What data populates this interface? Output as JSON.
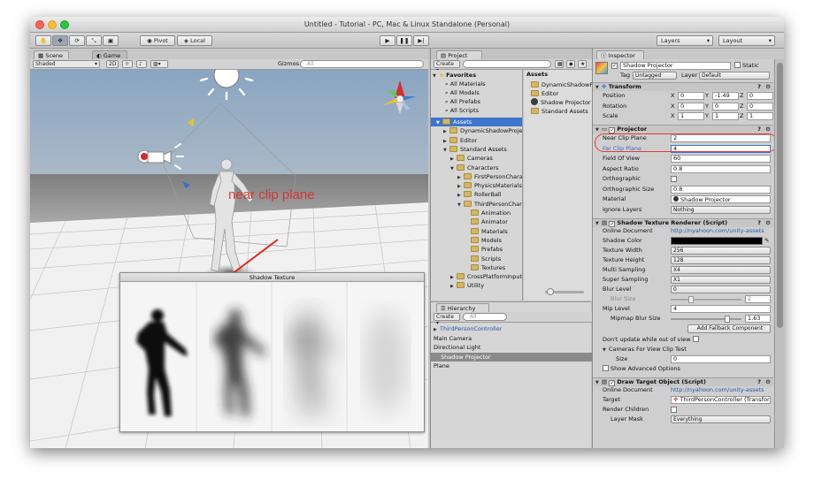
{
  "window": {
    "title": "Untitled - Tutorial - PC, Mac & Linux Standalone (Personal)"
  },
  "toolbar": {
    "pivot_label": "Pivot",
    "local_label": "Local",
    "layers_label": "Layers",
    "layout_label": "Layout"
  },
  "scene": {
    "tabs": [
      "Scene",
      "Game"
    ],
    "shading_mode": "Shaded",
    "mode_2d": "2D",
    "gizmos_label": "Gizmos",
    "search_placeholder": "All",
    "annotation": "near clip plane",
    "preview_title": "Shadow Texture"
  },
  "project": {
    "tab": "Project",
    "create_label": "Create",
    "favorites": {
      "label": "Favorites",
      "items": [
        "All Materials",
        "All Models",
        "All Prefabs",
        "All Scripts"
      ]
    },
    "tree": [
      {
        "label": "Assets",
        "depth": 0,
        "selected": true
      },
      {
        "label": "DynamicShadowProjector",
        "depth": 1
      },
      {
        "label": "Editor",
        "depth": 1
      },
      {
        "label": "Standard Assets",
        "depth": 1
      },
      {
        "label": "Cameras",
        "depth": 2
      },
      {
        "label": "Characters",
        "depth": 2
      },
      {
        "label": "FirstPersonCharacter",
        "depth": 3
      },
      {
        "label": "PhysicsMaterials",
        "depth": 3
      },
      {
        "label": "RollerBall",
        "depth": 3
      },
      {
        "label": "ThirdPersonCharacter",
        "depth": 3
      },
      {
        "label": "Animation",
        "depth": 4
      },
      {
        "label": "Animator",
        "depth": 4
      },
      {
        "label": "Materials",
        "depth": 4
      },
      {
        "label": "Models",
        "depth": 4
      },
      {
        "label": "Prefabs",
        "depth": 4
      },
      {
        "label": "Scripts",
        "depth": 4
      },
      {
        "label": "Textures",
        "depth": 4
      },
      {
        "label": "CrossPlatformInput",
        "depth": 2
      },
      {
        "label": "Utility",
        "depth": 2
      }
    ],
    "assets_header": "Assets",
    "assets": [
      "DynamicShadowProjector",
      "Editor",
      "Shadow Projector",
      "Standard Assets"
    ]
  },
  "hierarchy": {
    "tab": "Hierarchy",
    "create_label": "Create",
    "search_placeholder": "All",
    "items": [
      {
        "label": "ThirdPersonController",
        "indent": 0,
        "prefab": true
      },
      {
        "label": "Main Camera",
        "indent": 0
      },
      {
        "label": "Directional Light",
        "indent": 0
      },
      {
        "label": "Shadow Projector",
        "indent": 1,
        "selected": true
      },
      {
        "label": "Plane",
        "indent": 0
      }
    ]
  },
  "inspector": {
    "tab": "Inspector",
    "object_name": "Shadow Projector",
    "static_label": "Static",
    "tag_label": "Tag",
    "tag_value": "Untagged",
    "layer_label": "Layer",
    "layer_value": "Default",
    "transform": {
      "title": "Transform",
      "rows": [
        {
          "label": "Position",
          "x": "0",
          "y": "-1.49",
          "z": "0"
        },
        {
          "label": "Rotation",
          "x": "0",
          "y": "0",
          "z": "0"
        },
        {
          "label": "Scale",
          "x": "1",
          "y": "1",
          "z": "1"
        }
      ]
    },
    "projector": {
      "title": "Projector",
      "rows": [
        {
          "label": "Near Clip Plane",
          "value": "2"
        },
        {
          "label": "Far Clip Plane",
          "value": "4",
          "highlight": true
        },
        {
          "label": "Field Of View",
          "value": "60"
        },
        {
          "label": "Aspect Ratio",
          "value": "0.8"
        },
        {
          "label": "Orthographic",
          "value": "",
          "checkbox": true
        },
        {
          "label": "Orthographic Size",
          "value": "0.8"
        },
        {
          "label": "Material",
          "value": "Shadow Projector",
          "object": true
        },
        {
          "label": "Ignore Layers",
          "value": "Nothing",
          "dropdown": true
        }
      ]
    },
    "shadow_renderer": {
      "title": "Shadow Texture Renderer (Script)",
      "online_doc_label": "Online Document",
      "online_doc_value": "http://nyahoon.com/unity-assets",
      "shadow_color_label": "Shadow Color",
      "texture_width_label": "Texture Width",
      "texture_width": "256",
      "texture_height_label": "Texture Height",
      "texture_height": "128",
      "multi_sampling_label": "Multi Sampling",
      "multi_sampling": "X4",
      "super_sampling_label": "Super Sampling",
      "super_sampling": "X1",
      "blur_level_label": "Blur Level",
      "blur_level": "0",
      "blur_size_label": "Blur Size",
      "blur_size": "2",
      "mip_level_label": "Mip Level",
      "mip_level": "4",
      "mipmap_blur_label": "Mipmap Blur Size",
      "mipmap_blur": "1.63",
      "mipmap_blur_fraction": 0.8,
      "fallback_button": "Add Fallback Component",
      "dont_update_label": "Don't update while out of view",
      "cameras_label": "Cameras For View Clip Test",
      "size_label": "Size",
      "size_value": "0",
      "advanced_label": "Show Advanced Options"
    },
    "draw_target": {
      "title": "Draw Target Object (Script)",
      "online_doc_label": "Online Document",
      "online_doc_value": "http://nyahoon.com/unity-assets",
      "target_label": "Target",
      "target_value": "ThirdPersonController (Transform)",
      "render_children_label": "Render Children",
      "layer_mask_label": "Layer Mask",
      "layer_mask_value": "Everything"
    }
  },
  "colors": {
    "accent": "#3d75cc",
    "highlight_circle": "#e23b2f",
    "scene_sky": "#8fa9c4",
    "scene_ground": "#f4f4f4"
  }
}
